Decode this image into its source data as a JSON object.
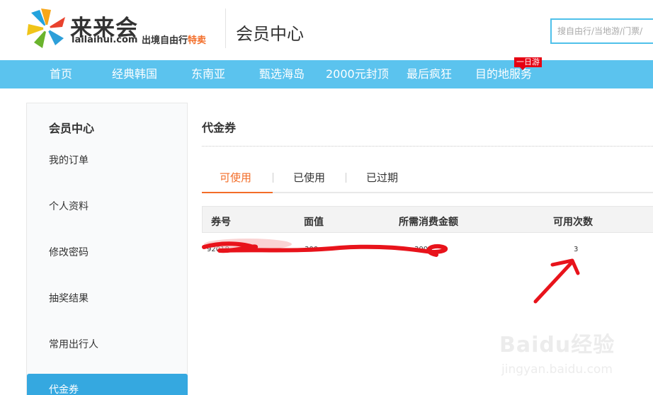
{
  "header": {
    "brand_cn": "来来会",
    "brand_en": "lailaihui.com",
    "slogan_prefix": "出境自由行",
    "slogan_highlight": "特卖",
    "page_title": "会员中心",
    "search_placeholder": "搜自由行/当地游/门票/"
  },
  "nav": {
    "items": [
      "首页",
      "经典韩国",
      "东南亚",
      "甄选海岛",
      "2000元封顶",
      "最后疯狂",
      "目的地服务"
    ],
    "badge": "一日游"
  },
  "sidebar": {
    "title": "会员中心",
    "items": [
      "我的订单",
      "个人资料",
      "修改密码",
      "抽奖结果",
      "常用出行人",
      "代金券"
    ],
    "active_index": 5
  },
  "main": {
    "title": "代金券",
    "tabs": [
      "可使用",
      "已使用",
      "已过期"
    ],
    "active_tab": 0,
    "columns": [
      "券号",
      "面值",
      "所需消费金额",
      "可用次数"
    ],
    "rows": [
      {
        "code": "92018",
        "value": "300",
        "min_spend": "3000",
        "times": "3"
      }
    ]
  },
  "watermark": {
    "main": "Baidu经验",
    "sub": "jingyan.baidu.com"
  },
  "colors": {
    "nav_bg": "#5bc3ee",
    "accent_orange": "#f36d28",
    "sidebar_active": "#35a8e0",
    "annotation_red": "#e8131b"
  }
}
